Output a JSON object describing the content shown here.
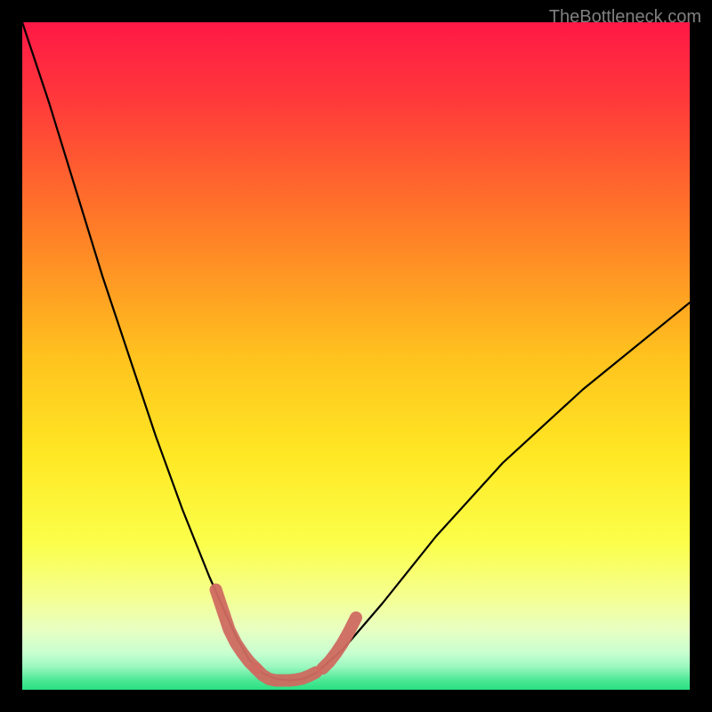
{
  "watermark": "TheBottleneck.com",
  "colors": {
    "gradient_top": "#ff1846",
    "gradient_upper_mid": "#ff6a2a",
    "gradient_mid": "#ffd82a",
    "gradient_lower_mid": "#fcff66",
    "gradient_low": "#f0ffb0",
    "gradient_bottom_band": "#b8ffb8",
    "gradient_bottom_edge": "#29e080",
    "curve": "#000000",
    "marker": "#cf6a60",
    "frame": "#000000"
  },
  "chart_data": {
    "type": "line",
    "title": "",
    "xlabel": "",
    "ylabel": "",
    "xlim": [
      0,
      100
    ],
    "ylim": [
      0,
      100
    ],
    "series": [
      {
        "name": "bottleneck-curve",
        "x": [
          0,
          4,
          8,
          12,
          16,
          20,
          24,
          28,
          32,
          34,
          36,
          38,
          40,
          42,
          44,
          48,
          54,
          62,
          72,
          84,
          100
        ],
        "y": [
          100,
          88,
          75,
          62,
          50,
          38,
          27,
          17,
          8,
          4.5,
          2.5,
          1.6,
          1.4,
          1.6,
          2.5,
          6,
          13,
          23,
          34,
          45,
          58
        ]
      }
    ],
    "highlighted_segments": [
      {
        "name": "left-descent-marker",
        "x": [
          29,
          30,
          31,
          32,
          33,
          34,
          35
        ],
        "y": [
          15,
          12,
          9,
          7,
          5.5,
          4.2,
          3.2
        ]
      },
      {
        "name": "trough-marker",
        "x": [
          35,
          36,
          37,
          38,
          39,
          40,
          41,
          42,
          43,
          44
        ],
        "y": [
          3.2,
          2.2,
          1.6,
          1.4,
          1.4,
          1.4,
          1.5,
          1.7,
          2.1,
          2.6
        ]
      },
      {
        "name": "right-ascent-marker",
        "x": [
          45,
          46,
          47,
          48,
          49,
          50
        ],
        "y": [
          3.2,
          4.2,
          5.5,
          7,
          8.8,
          10.8
        ]
      }
    ],
    "minimum_at_x": 39
  }
}
